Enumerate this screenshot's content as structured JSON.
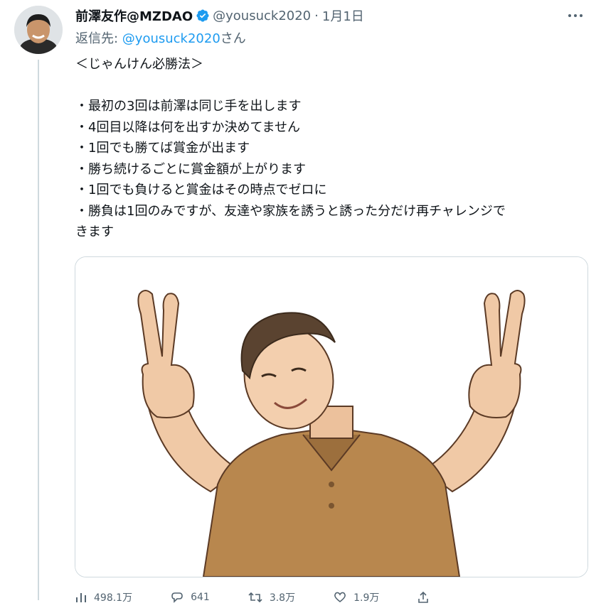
{
  "tweet": {
    "display_name": "前澤友作@MZDAO",
    "handle": "@yousuck2020",
    "separator": "·",
    "date": "1月1日",
    "reply_prefix": "返信先: ",
    "reply_mention": "@yousuck2020",
    "reply_suffix": "さん",
    "title_line": "＜じゃんけん必勝法＞",
    "rules": [
      "・最初の3回は前澤は同じ手を出します",
      "・4回目以降は何を出すか決めてません",
      "・1回でも勝てば賞金が出ます",
      "・勝ち続けるごとに賞金額が上がります",
      "・1回でも負けると賞金はその時点でゼロに",
      "・勝負は1回のみですが、友達や家族を誘うと誘った分だけ再チャレンジで",
      "きます"
    ]
  },
  "actions": {
    "views_icon": "bar-chart-icon",
    "views": "498.1万",
    "replies_icon": "reply-icon",
    "replies": "641",
    "retweets_icon": "retweet-icon",
    "retweets": "3.8万",
    "likes_icon": "heart-icon",
    "likes": "1.9万",
    "share_icon": "share-icon"
  },
  "colors": {
    "link": "#1d9bf0",
    "secondary_text": "#536471",
    "verified_badge": "#1d9bf0",
    "border": "#cfd9de"
  }
}
